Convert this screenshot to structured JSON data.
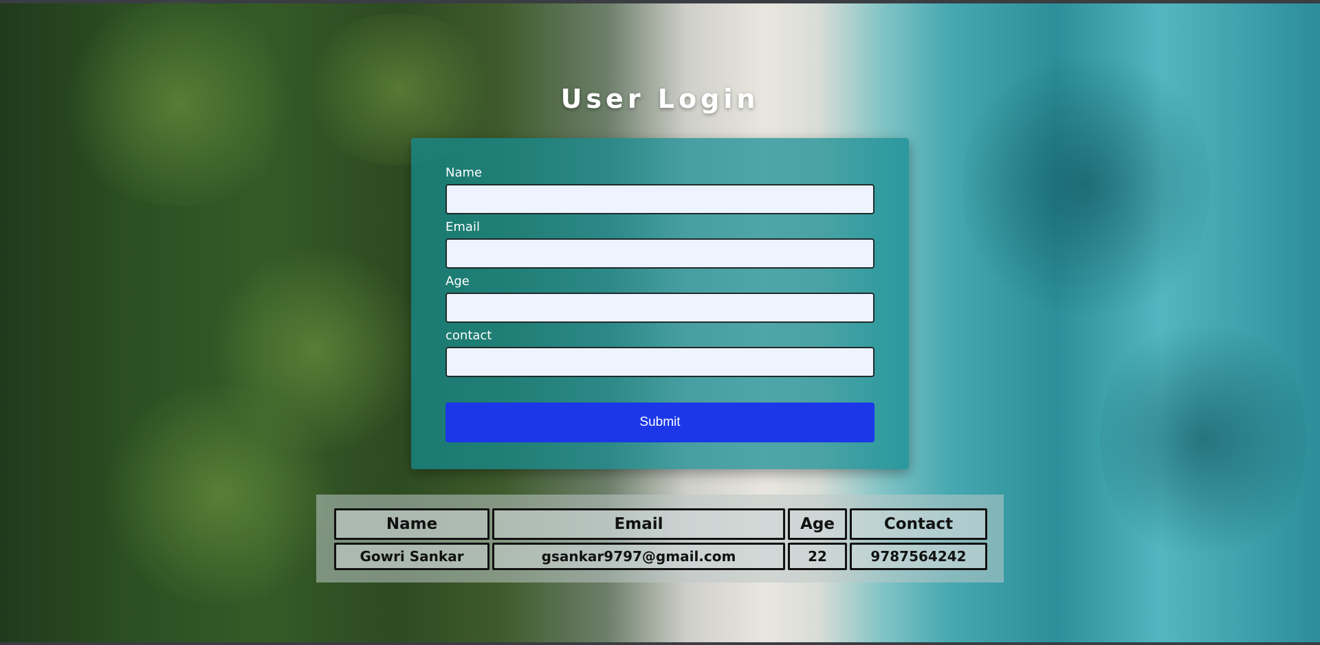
{
  "page": {
    "title": "User Login"
  },
  "form": {
    "fields": [
      {
        "label": "Name",
        "value": "",
        "placeholder": ""
      },
      {
        "label": "Email",
        "value": "",
        "placeholder": ""
      },
      {
        "label": "Age",
        "value": "",
        "placeholder": ""
      },
      {
        "label": "contact",
        "value": "",
        "placeholder": ""
      }
    ],
    "submit_label": "Submit"
  },
  "table": {
    "headers": [
      "Name",
      "Email",
      "Age",
      "Contact"
    ],
    "rows": [
      [
        "Gowri Sankar",
        "gsankar9797@gmail.com",
        "22",
        "9787564242"
      ]
    ]
  },
  "colors": {
    "form_card": "#148c91",
    "submit_button": "#1b37e8",
    "input_background": "#eef4ff"
  }
}
